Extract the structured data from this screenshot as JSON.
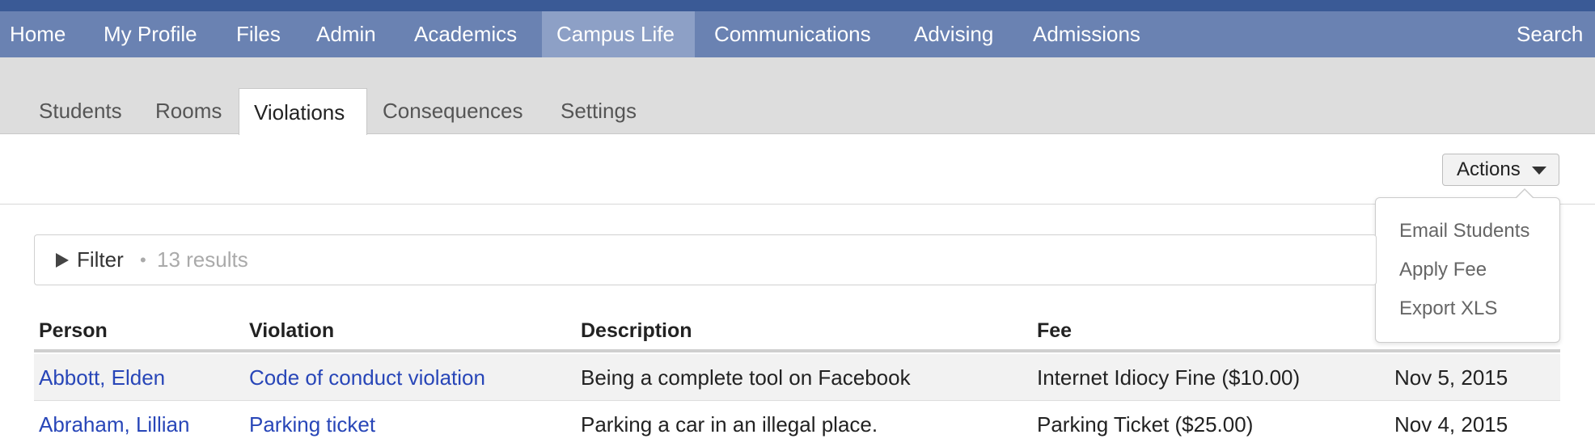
{
  "main_nav": {
    "items": [
      {
        "label": "Home"
      },
      {
        "label": "My Profile"
      },
      {
        "label": "Files"
      },
      {
        "label": "Admin"
      },
      {
        "label": "Academics"
      },
      {
        "label": "Campus Life",
        "active": true
      },
      {
        "label": "Communications"
      },
      {
        "label": "Advising"
      },
      {
        "label": "Admissions"
      }
    ],
    "search_label": "Search"
  },
  "sub_tabs": [
    {
      "label": "Students"
    },
    {
      "label": "Rooms"
    },
    {
      "label": "Violations",
      "active": true
    },
    {
      "label": "Consequences"
    },
    {
      "label": "Settings"
    }
  ],
  "actions": {
    "label": "Actions",
    "menu": [
      "Email Students",
      "Apply Fee",
      "Export XLS"
    ]
  },
  "filter": {
    "label": "Filter",
    "separator": "•",
    "results": "13 results"
  },
  "table": {
    "headers": [
      "Person",
      "Violation",
      "Description",
      "Fee"
    ],
    "rows": [
      {
        "person": "Abbott, Elden",
        "violation": "Code of conduct violation",
        "description": "Being a complete tool on Facebook",
        "fee": "Internet Idiocy Fine ($10.00)",
        "date": "Nov 5, 2015"
      },
      {
        "person": "Abraham, Lillian",
        "violation": "Parking ticket",
        "description": "Parking a car in an illegal place.",
        "fee": "Parking Ticket ($25.00)",
        "date": "Nov 4, 2015"
      }
    ]
  },
  "colors": {
    "nav_bg": "#6a82b2",
    "nav_active": "#8da0c6",
    "top_strip": "#3a5a96",
    "link": "#2846b8",
    "subbar_bg": "#dddddd"
  }
}
